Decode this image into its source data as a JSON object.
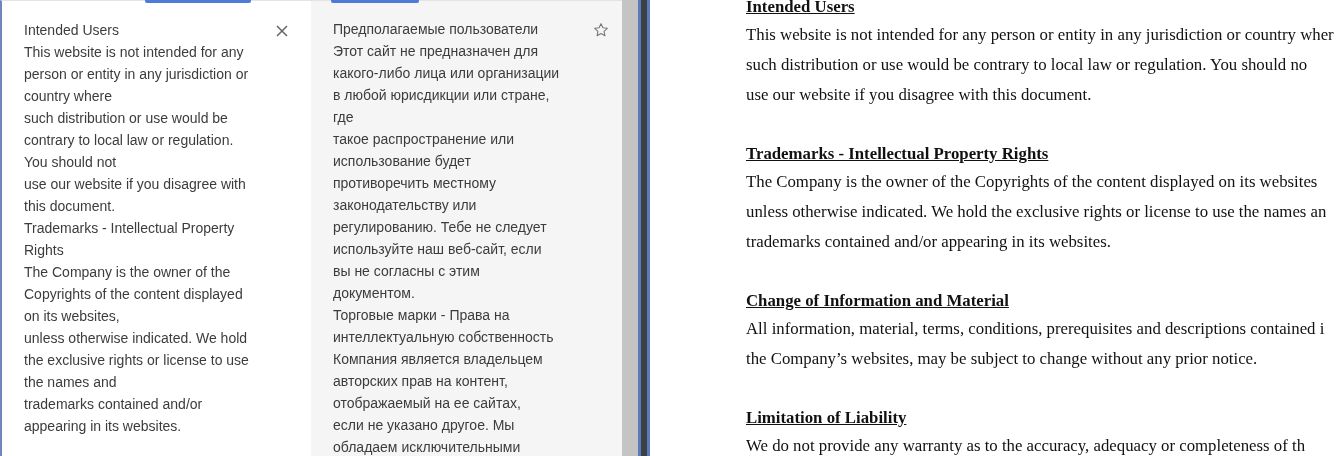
{
  "source_panel": {
    "lines": [
      "Intended Users",
      "This website is not intended for any",
      "person or entity in any jurisdiction or",
      "country where",
      "such distribution or use would be",
      "contrary to local law or regulation.",
      "You should not",
      "use our website if you disagree with",
      "this document.",
      "Trademarks - Intellectual Property",
      "Rights",
      "The Company is the owner of the",
      "Copyrights of the content displayed",
      "on its websites,",
      "unless otherwise indicated. We hold",
      "the exclusive rights or license to use",
      "the names and",
      "trademarks contained and/or",
      "appearing in its websites."
    ]
  },
  "translation_panel": {
    "lines": [
      "Предполагаемые пользователи",
      "Этот сайт не предназначен для",
      "какого-либо лица или организации",
      "в любой юрисдикции или стране,",
      "где",
      "такое распространение или",
      "использование будет",
      "противоречить местному",
      "законодательству или",
      "регулированию. Тебе не следует",
      "используйте наш веб-сайт, если",
      "вы не согласны с этим",
      "документом.",
      "Торговые марки - Права на",
      "интеллектуальную собственность",
      "Компания является владельцем",
      "авторских прав на контент,",
      "отображаемый на ее сайтах,",
      "если не указано другое. Мы",
      "обладаем исключительными"
    ]
  },
  "document": {
    "sections": [
      {
        "heading": "Intended Users",
        "lines": [
          "This website is not intended for any person or entity in any jurisdiction or country wher",
          "such distribution or use would be contrary to local law or regulation. You should no",
          "use our website if you disagree with this document."
        ]
      },
      {
        "heading": "Trademarks - Intellectual Property Rights",
        "lines": [
          "The Company is the owner of the Copyrights of the content displayed on its websites",
          "unless otherwise indicated. We hold the exclusive rights or license to use the names an",
          "trademarks contained and/or appearing in its websites."
        ]
      },
      {
        "heading": "Change of Information and Material",
        "lines": [
          "All information, material, terms, conditions, prerequisites and descriptions contained i",
          "the Company’s websites, may be subject to change without any prior notice."
        ]
      },
      {
        "heading": "Limitation of Liability",
        "lines": [
          "We do not provide any warranty as to the accuracy, adequacy or completeness of th"
        ]
      }
    ]
  }
}
